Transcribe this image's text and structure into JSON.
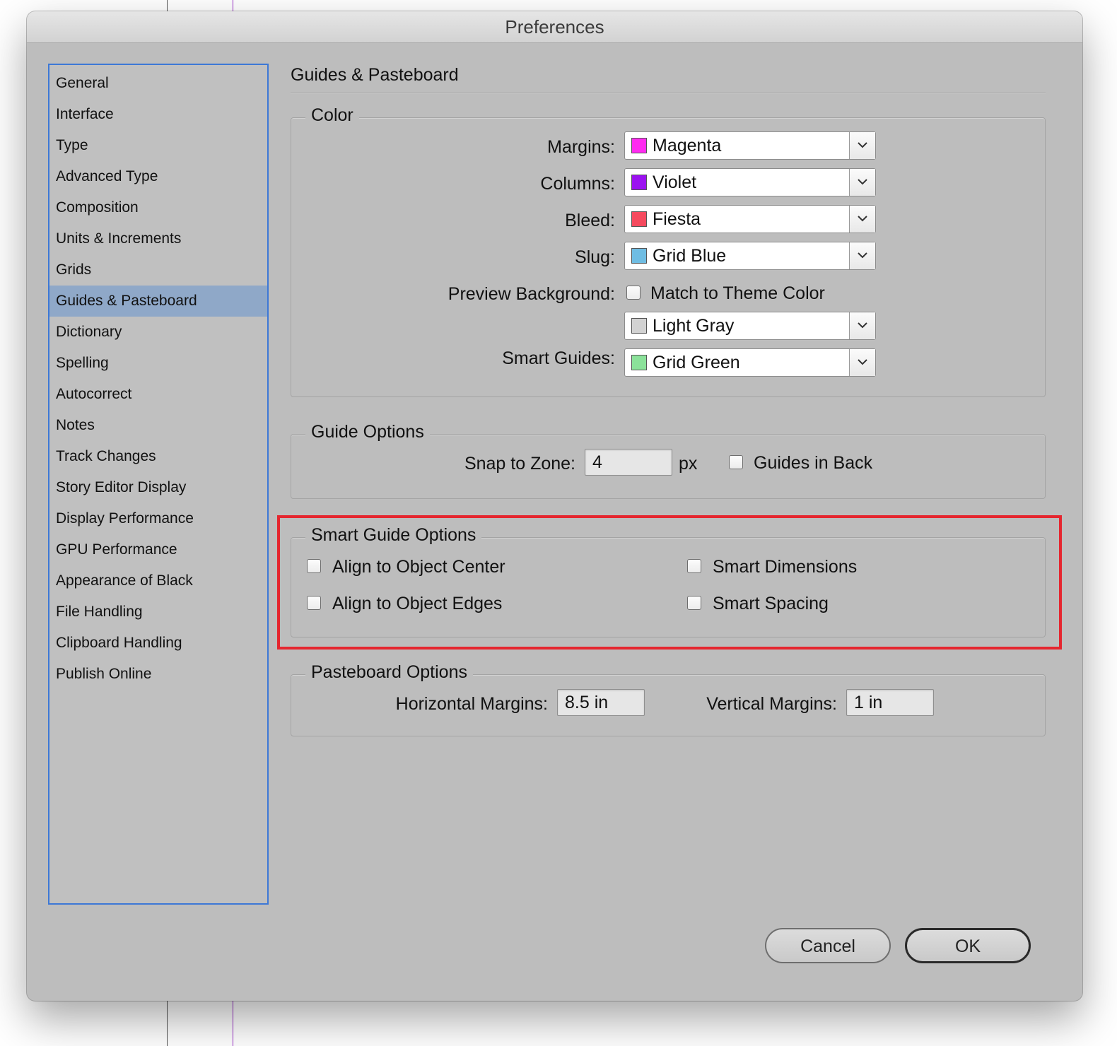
{
  "window": {
    "title": "Preferences"
  },
  "sidebar": {
    "items": [
      {
        "label": "General"
      },
      {
        "label": "Interface"
      },
      {
        "label": "Type"
      },
      {
        "label": "Advanced Type"
      },
      {
        "label": "Composition"
      },
      {
        "label": "Units & Increments"
      },
      {
        "label": "Grids"
      },
      {
        "label": "Guides & Pasteboard",
        "selected": true
      },
      {
        "label": "Dictionary"
      },
      {
        "label": "Spelling"
      },
      {
        "label": "Autocorrect"
      },
      {
        "label": "Notes"
      },
      {
        "label": "Track Changes"
      },
      {
        "label": "Story Editor Display"
      },
      {
        "label": "Display Performance"
      },
      {
        "label": "GPU Performance"
      },
      {
        "label": "Appearance of Black"
      },
      {
        "label": "File Handling"
      },
      {
        "label": "Clipboard Handling"
      },
      {
        "label": "Publish Online"
      }
    ]
  },
  "section": {
    "title": "Guides & Pasteboard"
  },
  "color": {
    "legend": "Color",
    "margins": {
      "label": "Margins:",
      "value": "Magenta",
      "swatch": "#ff2bf0"
    },
    "columns": {
      "label": "Columns:",
      "value": "Violet",
      "swatch": "#9b12f0"
    },
    "bleed": {
      "label": "Bleed:",
      "value": "Fiesta",
      "swatch": "#f54a5e"
    },
    "slug": {
      "label": "Slug:",
      "value": "Grid Blue",
      "swatch": "#6fbde3"
    },
    "preview_background": {
      "label": "Preview Background:",
      "match_theme_label": "Match to Theme Color",
      "match_theme_checked": false,
      "value": "Light Gray",
      "swatch": "#d2d2d2"
    },
    "smart_guides": {
      "label": "Smart Guides:",
      "value": "Grid Green",
      "swatch": "#8be29a"
    }
  },
  "guide_options": {
    "legend": "Guide Options",
    "snap_label": "Snap to Zone:",
    "snap_value": "4",
    "snap_unit": "px",
    "guides_in_back_label": "Guides in Back",
    "guides_in_back_checked": false
  },
  "smart_guide_options": {
    "legend": "Smart Guide Options",
    "align_center_label": "Align to Object Center",
    "align_edges_label": "Align to Object Edges",
    "smart_dimensions_label": "Smart Dimensions",
    "smart_spacing_label": "Smart Spacing",
    "highlight_color": "#e5262f"
  },
  "pasteboard_options": {
    "legend": "Pasteboard Options",
    "horizontal_label": "Horizontal Margins:",
    "horizontal_value": "8.5 in",
    "vertical_label": "Vertical Margins:",
    "vertical_value": "1 in"
  },
  "buttons": {
    "cancel": "Cancel",
    "ok": "OK"
  }
}
